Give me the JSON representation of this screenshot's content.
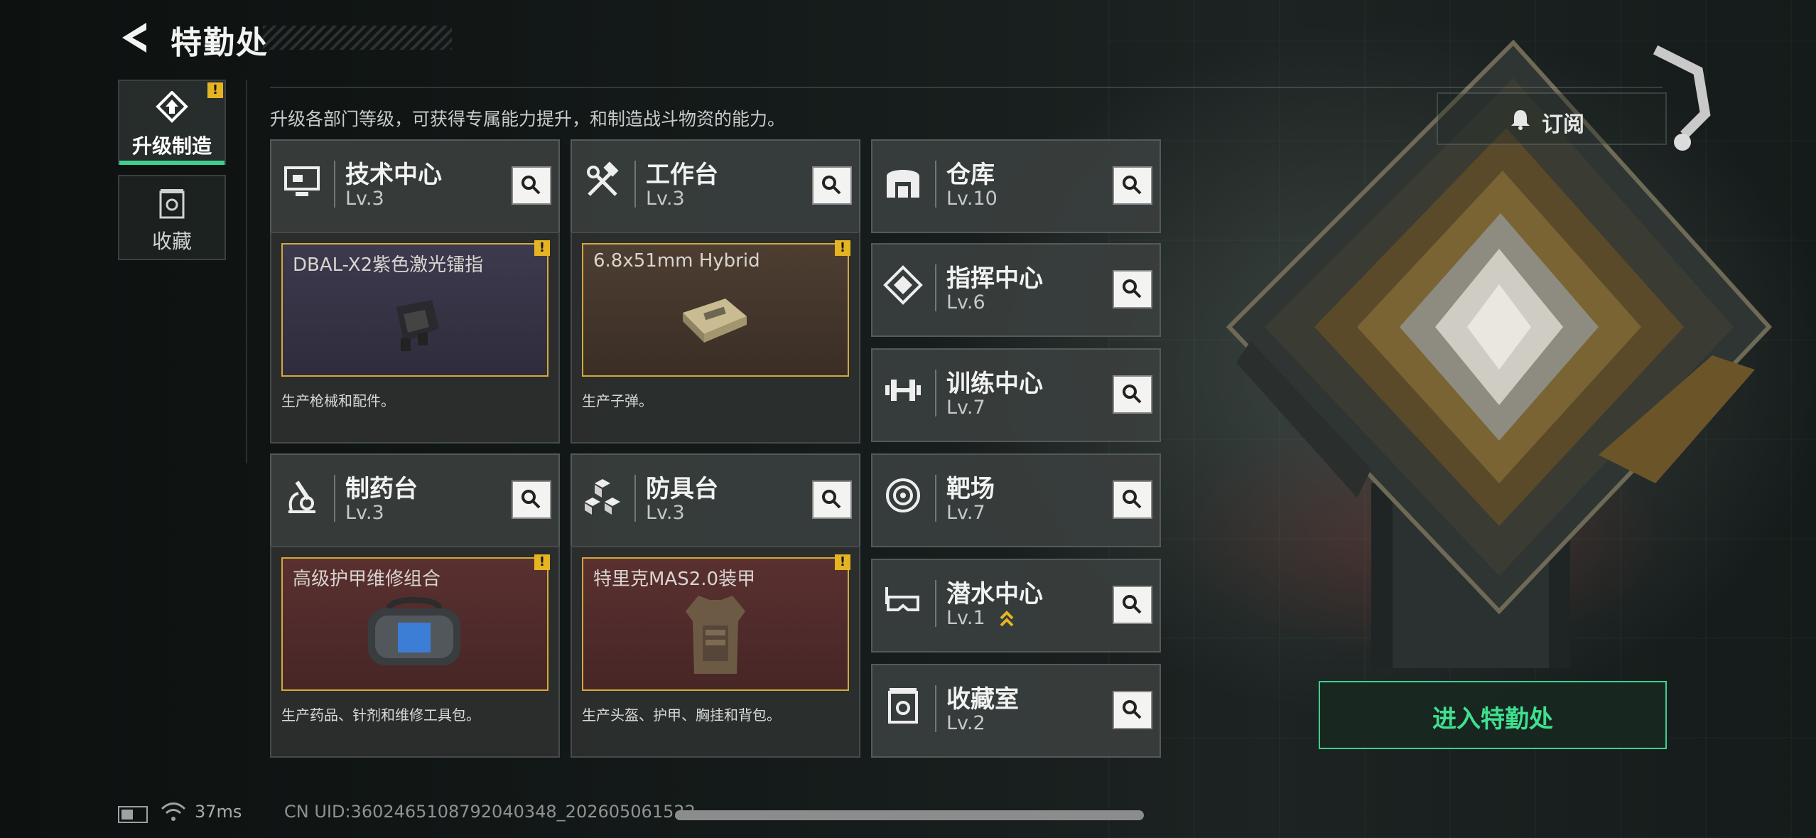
{
  "header": {
    "title": "特勤处"
  },
  "nav": {
    "tabs": [
      {
        "label": "升级制造",
        "active": true,
        "badge": "!"
      },
      {
        "label": "收藏",
        "active": false
      }
    ]
  },
  "subtitle": "升级各部门等级，可获得专属能力提升，和制造战斗物资的能力。",
  "subscribe_label": "订阅",
  "workshops": [
    {
      "name": "技术中心",
      "level": "Lv.3",
      "item": "DBAL-X2紫色激光镭指",
      "desc": "生产枪械和配件。",
      "badge": "!"
    },
    {
      "name": "工作台",
      "level": "Lv.3",
      "item": "6.8x51mm Hybrid",
      "desc": "生产子弹。",
      "badge": "!"
    },
    {
      "name": "制药台",
      "level": "Lv.3",
      "item": "高级护甲维修组合",
      "desc": "生产药品、针剂和维修工具包。",
      "badge": "!"
    },
    {
      "name": "防具台",
      "level": "Lv.3",
      "item": "特里克MAS2.0装甲",
      "desc": "生产头盔、护甲、胸挂和背包。",
      "badge": "!"
    }
  ],
  "facilities": [
    {
      "name": "仓库",
      "level": "Lv.10"
    },
    {
      "name": "指挥中心",
      "level": "Lv.6"
    },
    {
      "name": "训练中心",
      "level": "Lv.7"
    },
    {
      "name": "靶场",
      "level": "Lv.7"
    },
    {
      "name": "潜水中心",
      "level": "Lv.1"
    },
    {
      "name": "收藏室",
      "level": "Lv.2"
    }
  ],
  "enter_label": "进入特勤处",
  "status": {
    "ping": "37ms",
    "uid": "CN UID:3602465108792040348_202605061522"
  },
  "colors": {
    "accent": "#3fcf8e",
    "badge": "#e6b422",
    "item_border": "#d3a93f"
  },
  "icons": {
    "workshops": [
      "computer-icon",
      "hammer-wrench-icon",
      "microscope-icon",
      "armor-blocks-icon"
    ],
    "facilities": [
      "warehouse-icon",
      "chip-icon",
      "dumbbell-icon",
      "target-icon",
      "diving-mask-icon",
      "collection-icon"
    ]
  }
}
